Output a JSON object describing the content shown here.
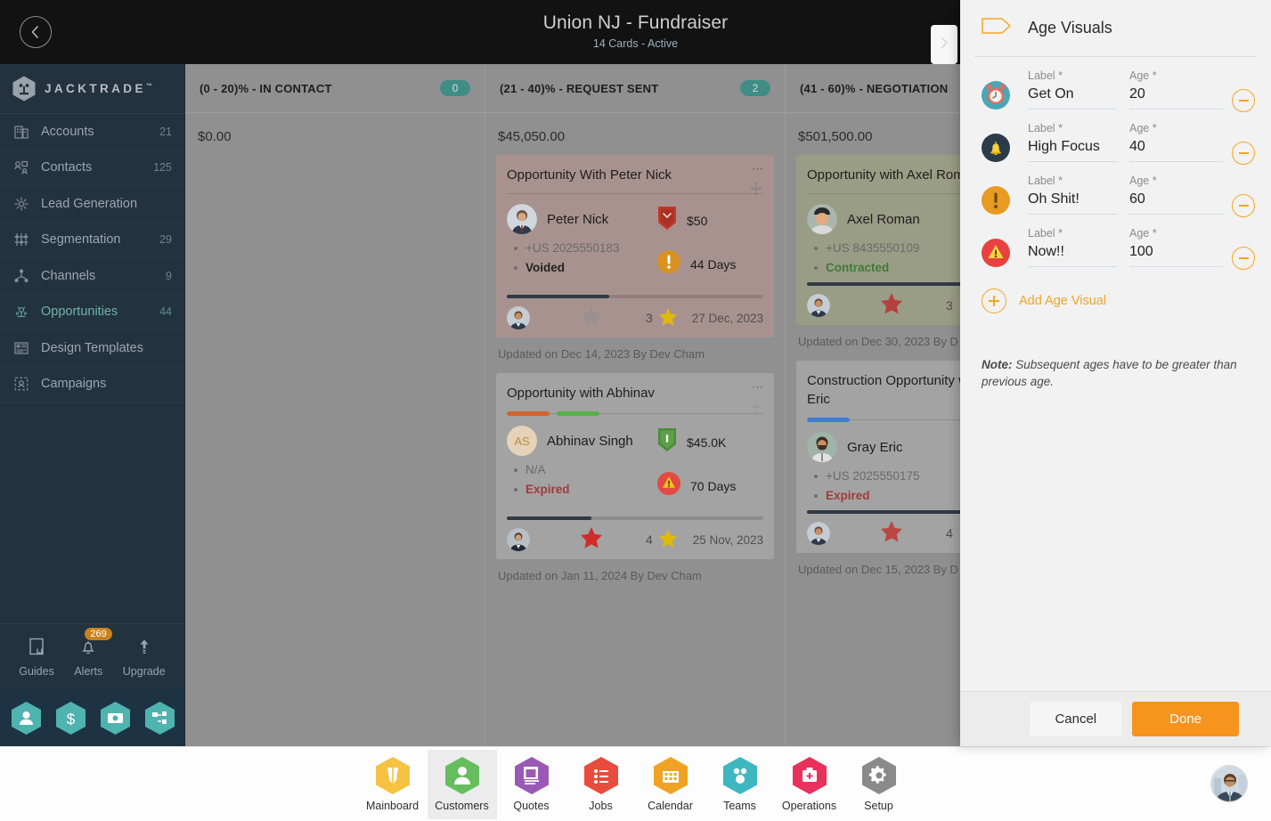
{
  "topbar": {
    "back_icon": "chevron-left-icon",
    "title": "Union NJ - Fundraiser",
    "subtitle": "14 Cards - Active",
    "next_icon": "chevron-right-icon"
  },
  "sidebar": {
    "brand": "JACKTRADE",
    "brand_tm": "™",
    "items": [
      {
        "label": "Accounts",
        "count": "21",
        "icon": "building-icon",
        "active": false
      },
      {
        "label": "Contacts",
        "count": "125",
        "icon": "contacts-icon",
        "active": false
      },
      {
        "label": "Lead Generation",
        "count": "",
        "icon": "lead-gen-icon",
        "active": false
      },
      {
        "label": "Segmentation",
        "count": "29",
        "icon": "segmentation-icon",
        "active": false
      },
      {
        "label": "Channels",
        "count": "9",
        "icon": "channels-icon",
        "active": false
      },
      {
        "label": "Opportunities",
        "count": "44",
        "icon": "opportunities-icon",
        "active": true
      },
      {
        "label": "Design Templates",
        "count": "",
        "icon": "templates-icon",
        "active": false
      },
      {
        "label": "Campaigns",
        "count": "",
        "icon": "campaigns-icon",
        "active": false
      }
    ],
    "tools": [
      {
        "label": "Guides",
        "icon": "book-icon",
        "badge": ""
      },
      {
        "label": "Alerts",
        "icon": "bell-icon",
        "badge": "269"
      },
      {
        "label": "Upgrade",
        "icon": "arrow-up-icon",
        "badge": ""
      }
    ],
    "quick_hexes": [
      {
        "icon": "person-hex-icon"
      },
      {
        "icon": "dollar-hex-icon"
      },
      {
        "icon": "payment-hex-icon"
      },
      {
        "icon": "workflow-hex-icon"
      }
    ]
  },
  "board": {
    "columns": [
      {
        "title": "(0 - 20)% - IN CONTACT",
        "count": "0",
        "sum": "$0.00",
        "cards": []
      },
      {
        "title": "(21 - 40)% - REQUEST SENT",
        "count": "2",
        "sum": "$45,050.00",
        "cards": [
          {
            "title": "Opportunity With Peter Nick",
            "color": "c-rose",
            "tags": [],
            "divider": true,
            "person": "Peter Nick",
            "avatar_kind": "photo-male-suit",
            "initials": "",
            "phone": "+US 2025550183",
            "status": "Voided",
            "status_kind": "strong",
            "amount": "$50",
            "amount_icon": "shield-red-icon",
            "days": "44 Days",
            "days_icon": "warn-circle-orange-icon",
            "progress": 40,
            "star_gray": true,
            "star_red": false,
            "rating": "3",
            "date": "27 Dec, 2023",
            "updated": "Updated on Dec 14, 2023 By Dev Cham"
          },
          {
            "title": "Opportunity with Abhinav",
            "color": "c-gray",
            "tags": [
              "#d4622a",
              "#57b04a"
            ],
            "divider": false,
            "person": "Abhinav Singh",
            "avatar_kind": "initials",
            "initials": "AS",
            "phone": "N/A",
            "status": "Expired",
            "status_kind": "red",
            "amount": "$45.0K",
            "amount_icon": "shield-green-icon",
            "days": "70 Days",
            "days_icon": "warn-triangle-red-icon",
            "progress": 33,
            "star_gray": false,
            "star_red": true,
            "rating": "4",
            "date": "25 Nov, 2023",
            "updated": "Updated on Jan 11, 2024 By Dev Cham"
          }
        ]
      },
      {
        "title": "(41 - 60)% - NEGOTIATION",
        "count": "",
        "sum": "$501,500.00",
        "cards": [
          {
            "title": "Opportunity with Axel Roman",
            "color": "c-olive",
            "tags": [],
            "divider": true,
            "person": "Axel Roman",
            "avatar_kind": "photo-male-cap",
            "initials": "",
            "phone": "+US 8435550109",
            "status": "Contracted",
            "status_kind": "green",
            "amount": "",
            "amount_icon": "",
            "days": "",
            "days_icon": "",
            "progress": 100,
            "star_gray": false,
            "star_red": true,
            "rating": "3",
            "date": "",
            "updated": "Updated on Dec 30, 2023 By D"
          },
          {
            "title": "Construction Opportunity with Gray Eric",
            "color": "c-gray",
            "tags": [
              "#3f7fd0"
            ],
            "divider": false,
            "person": "Gray Eric",
            "avatar_kind": "photo-male-beard",
            "initials": "",
            "phone": "+US 2025550175",
            "status": "Expired",
            "status_kind": "red",
            "amount": "",
            "amount_icon": "",
            "days": "",
            "days_icon": "",
            "progress": 100,
            "star_gray": false,
            "star_red": true,
            "rating": "4",
            "date": "",
            "updated": "Updated on Dec 15, 2023 By D"
          }
        ]
      }
    ]
  },
  "bottom_nav": {
    "items": [
      {
        "label": "Mainboard",
        "icon": "mainboard-icon",
        "color": "#f5c242",
        "active": false
      },
      {
        "label": "Customers",
        "icon": "customers-icon",
        "color": "#65bd5e",
        "active": true
      },
      {
        "label": "Quotes",
        "icon": "quotes-icon",
        "color": "#9b59b6",
        "active": false
      },
      {
        "label": "Jobs",
        "icon": "jobs-icon",
        "color": "#e74c3c",
        "active": false
      },
      {
        "label": "Calendar",
        "icon": "calendar-icon",
        "color": "#f0a323",
        "active": false
      },
      {
        "label": "Teams",
        "icon": "teams-icon",
        "color": "#3fb7c0",
        "active": false
      },
      {
        "label": "Operations",
        "icon": "operations-icon",
        "color": "#e8315c",
        "active": false
      },
      {
        "label": "Setup",
        "icon": "setup-icon",
        "color": "#8a8a8a",
        "active": false
      }
    ],
    "avatar": "user-avatar"
  },
  "panel": {
    "tag_icon": "tag-outline-icon",
    "title": "Age Visuals",
    "rows": [
      {
        "icon": "alarm-clock-icon",
        "label_caption": "Label",
        "label_value": "Get On",
        "age_caption": "Age",
        "age_value": "20",
        "remove_icon": "minus-circle-icon"
      },
      {
        "icon": "bell-dark-icon",
        "label_caption": "Label",
        "label_value": "High Focus",
        "age_caption": "Age",
        "age_value": "40",
        "remove_icon": "minus-circle-icon"
      },
      {
        "icon": "exclaim-orange-icon",
        "label_caption": "Label",
        "label_value": "Oh Shit!",
        "age_caption": "Age",
        "age_value": "60",
        "remove_icon": "minus-circle-icon"
      },
      {
        "icon": "warn-triangle-icon",
        "label_caption": "Label",
        "label_value": "Now!!",
        "age_caption": "Age",
        "age_value": "100",
        "remove_icon": "minus-circle-icon"
      }
    ],
    "required_mark": "*",
    "add_label": "Add Age Visual",
    "add_icon": "plus-circle-icon",
    "note_prefix": "Note:",
    "note_text": " Subsequent ages have to be greater than previous age.",
    "cancel_label": "Cancel",
    "done_label": "Done",
    "accent_color": "#f5a623",
    "done_color": "#f7941e"
  }
}
